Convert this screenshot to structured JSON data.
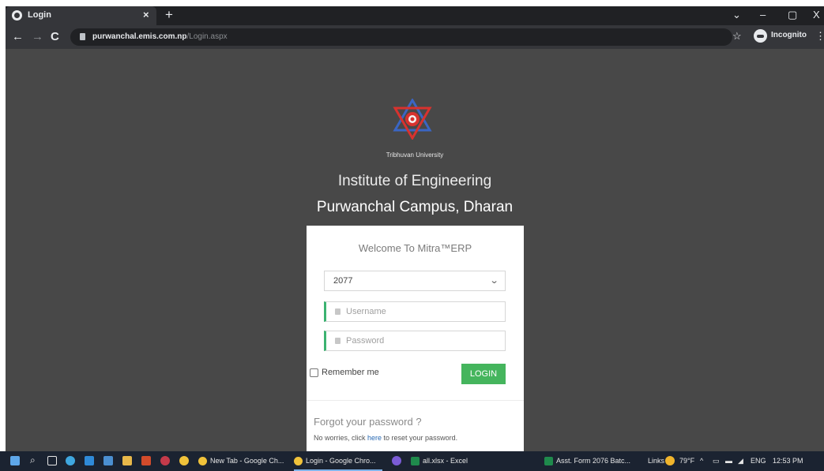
{
  "browser": {
    "tab_title": "Login",
    "tab_close": "×",
    "new_tab": "+",
    "url_host": "purwanchal.emis.com.np",
    "url_path": "/Login.aspx",
    "incognito_label": "Incognito",
    "window_controls": {
      "dropdown": "⌄",
      "minimize": "–",
      "maximize": "▢",
      "close": "X"
    }
  },
  "page": {
    "university": "Tribhuvan University",
    "institute": "Institute of Engineering",
    "campus": "Purwanchal Campus, Dharan",
    "login": {
      "welcome": "Welcome To Mitra™ERP",
      "year_select": "2077",
      "username_placeholder": "Username",
      "password_placeholder": "Password",
      "remember_label": "Remember me",
      "login_button": "LOGIN",
      "forgot_title": "Forgot your password ?",
      "reset_prefix": "No worries, click ",
      "reset_link": "here",
      "reset_suffix": " to reset your password."
    }
  },
  "taskbar": {
    "items": [
      {
        "label": "New Tab - Google Ch...",
        "icon": "chrome-icon"
      },
      {
        "label": "Login - Google Chro...",
        "icon": "chrome-icon"
      },
      {
        "label": "all.xlsx - Excel",
        "icon": "excel-icon"
      },
      {
        "label": "Asst. Form 2076 Batc...",
        "icon": "excel-icon"
      }
    ],
    "links_label": "Links",
    "weather": "79°F",
    "language": "ENG",
    "time": "12:53 PM"
  },
  "colors": {
    "page_background": "#484848",
    "login_button": "#45b55d",
    "field_accent": "#3cb371",
    "link": "#2a6ab3"
  }
}
